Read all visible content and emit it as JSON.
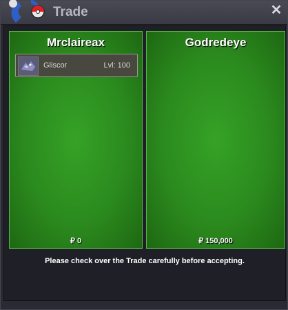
{
  "window": {
    "title": "Trade",
    "close_icon": "close-icon"
  },
  "trade": {
    "left": {
      "name": "Mrclaireax",
      "money": "₽ 0",
      "items": [
        {
          "icon": "gliscor-sprite-icon",
          "name": "Gliscor",
          "level": "Lvl: 100"
        }
      ]
    },
    "right": {
      "name": "Godredeye",
      "money": "₽ 150,000",
      "items": []
    },
    "message": "Please check over the Trade carefully before accepting."
  },
  "colors": {
    "panel_green": "#2b8a1e",
    "panel_border": "#58b84a",
    "background": "#2a2a33"
  }
}
